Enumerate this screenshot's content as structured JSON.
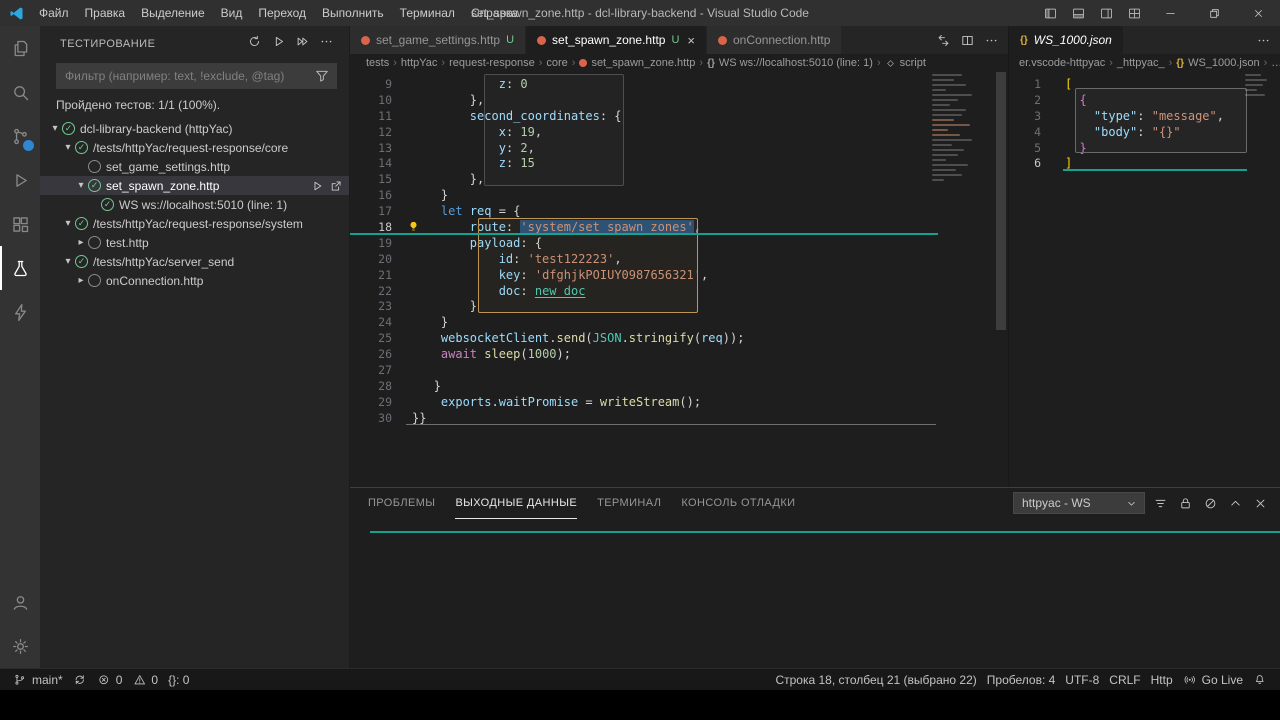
{
  "titlebar": {
    "menus": [
      "Файл",
      "Правка",
      "Выделение",
      "Вид",
      "Переход",
      "Выполнить",
      "Терминал",
      "Справка"
    ],
    "title": "set_spawn_zone.http - dcl-library-backend - Visual Studio Code",
    "layout_controls": [
      {
        "name": "toggle-primary-sidebar",
        "icon": "layoutL"
      },
      {
        "name": "toggle-panel",
        "icon": "layoutB"
      },
      {
        "name": "toggle-secondary-sidebar",
        "icon": "layoutR"
      },
      {
        "name": "customize-layout",
        "icon": "layoutG"
      }
    ],
    "window_controls": [
      {
        "name": "minimize",
        "icon": "minimize"
      },
      {
        "name": "restore",
        "icon": "restore"
      },
      {
        "name": "close-window",
        "icon": "close"
      }
    ]
  },
  "activity_bar": {
    "top": [
      {
        "name": "explorer",
        "icon": "files"
      },
      {
        "name": "search",
        "icon": "search"
      },
      {
        "name": "source-control",
        "icon": "scm",
        "badge": true
      },
      {
        "name": "run-and-debug",
        "icon": "debug"
      },
      {
        "name": "extensions",
        "icon": "ext"
      },
      {
        "name": "testing",
        "icon": "beaker",
        "active": true
      },
      {
        "name": "httpyac",
        "icon": "bolt"
      }
    ],
    "bottom": [
      {
        "name": "accounts",
        "icon": "account"
      },
      {
        "name": "settings",
        "icon": "gear"
      }
    ]
  },
  "sidebar": {
    "title": "ТЕСТИРОВАНИЕ",
    "actions": [
      {
        "name": "refresh-tests",
        "icon": "refresh"
      },
      {
        "name": "run-all-tests",
        "icon": "play"
      },
      {
        "name": "run-selected-tests",
        "icon": "playAll"
      },
      {
        "name": "more-actions",
        "icon": "more"
      }
    ],
    "filter_placeholder": "Фильтр (например: text, !exclude, @tag)",
    "summary": "Пройдено тестов: 1/1 (100%).",
    "tree": [
      {
        "label": "dcl-library-backend (httpYac)",
        "depth": 0,
        "chevron": "down",
        "state": "pass"
      },
      {
        "label": "/tests/httpYac/request-response/core",
        "depth": 1,
        "chevron": "down",
        "state": "pass"
      },
      {
        "label": "set_game_settings.http",
        "depth": 2,
        "chevron": "none",
        "state": "ring"
      },
      {
        "label": "set_spawn_zone.http",
        "depth": 2,
        "chevron": "down",
        "state": "pass",
        "selected": true,
        "actions": [
          "run",
          "goto"
        ]
      },
      {
        "label": "WS ws://localhost:5010 (line: 1)",
        "depth": 3,
        "chevron": "none",
        "state": "pass"
      },
      {
        "label": "/tests/httpYac/request-response/system",
        "depth": 1,
        "chevron": "down",
        "state": "pass"
      },
      {
        "label": "test.http",
        "depth": 2,
        "chevron": "right",
        "state": "ring"
      },
      {
        "label": "/tests/httpYac/server_send",
        "depth": 1,
        "chevron": "down",
        "state": "pass"
      },
      {
        "label": "onConnection.http",
        "depth": 2,
        "chevron": "right",
        "state": "ring"
      }
    ]
  },
  "editor": {
    "tabs": [
      {
        "label": "set_game_settings.http",
        "badge": "U",
        "active": false
      },
      {
        "label": "set_spawn_zone.http",
        "badge": "U",
        "active": true,
        "close": true
      },
      {
        "label": "onConnection.http",
        "badge": "",
        "active": false
      }
    ],
    "tab_actions": [
      {
        "name": "compare-changes",
        "icon": "compare"
      },
      {
        "name": "split-editor",
        "icon": "split"
      },
      {
        "name": "more-editor-actions",
        "icon": "more"
      }
    ],
    "breadcrumbs": [
      {
        "label": "tests"
      },
      {
        "label": "httpYac"
      },
      {
        "label": "request-response"
      },
      {
        "label": "core"
      },
      {
        "label": "set_spawn_zone.http",
        "icon": "file"
      },
      {
        "label": "WS ws://localhost:5010 (line: 1)",
        "icon": "braces"
      },
      {
        "label": "script",
        "icon": "symbol"
      }
    ],
    "lines": [
      {
        "n": 9,
        "i": 12,
        "t": [
          [
            "var",
            "z"
          ],
          [
            "pun",
            ": "
          ],
          [
            "num",
            "0"
          ]
        ]
      },
      {
        "n": 10,
        "i": 8,
        "t": [
          [
            "pun",
            "},"
          ]
        ]
      },
      {
        "n": 11,
        "i": 8,
        "t": [
          [
            "var",
            "second_coordinates"
          ],
          [
            "pun",
            ": {"
          ]
        ]
      },
      {
        "n": 12,
        "i": 12,
        "t": [
          [
            "var",
            "x"
          ],
          [
            "pun",
            ": "
          ],
          [
            "num",
            "19"
          ],
          [
            "pun",
            ","
          ]
        ]
      },
      {
        "n": 13,
        "i": 12,
        "t": [
          [
            "var",
            "y"
          ],
          [
            "pun",
            ": "
          ],
          [
            "num",
            "2"
          ],
          [
            "pun",
            ","
          ]
        ]
      },
      {
        "n": 14,
        "i": 12,
        "t": [
          [
            "var",
            "z"
          ],
          [
            "pun",
            ": "
          ],
          [
            "num",
            "15"
          ]
        ]
      },
      {
        "n": 15,
        "i": 8,
        "t": [
          [
            "pun",
            "},"
          ]
        ]
      },
      {
        "n": 16,
        "i": 4,
        "t": [
          [
            "pun",
            "}"
          ]
        ]
      },
      {
        "n": 17,
        "i": 4,
        "t": [
          [
            "kw",
            "let"
          ],
          [
            "pun",
            " "
          ],
          [
            "var",
            "req"
          ],
          [
            "pun",
            " = {"
          ]
        ]
      },
      {
        "n": 18,
        "i": 8,
        "active": true,
        "t": [
          [
            "var",
            "route"
          ],
          [
            "pun",
            ": "
          ],
          [
            "strsel",
            "'system/set_spawn_zones'"
          ],
          [
            "pun",
            ","
          ]
        ]
      },
      {
        "n": 19,
        "i": 8,
        "t": [
          [
            "var",
            "payload"
          ],
          [
            "pun",
            ": {"
          ]
        ]
      },
      {
        "n": 20,
        "i": 12,
        "t": [
          [
            "var",
            "id"
          ],
          [
            "pun",
            ": "
          ],
          [
            "str",
            "'test122223'"
          ],
          [
            "pun",
            ","
          ]
        ]
      },
      {
        "n": 21,
        "i": 12,
        "t": [
          [
            "var",
            "key"
          ],
          [
            "pun",
            ": "
          ],
          [
            "str",
            "'dfghjkPOIUY0987656321'"
          ],
          [
            "pun",
            ","
          ]
        ]
      },
      {
        "n": 22,
        "i": 12,
        "t": [
          [
            "var",
            "doc"
          ],
          [
            "pun",
            ": "
          ],
          [
            "link",
            "new_doc"
          ]
        ]
      },
      {
        "n": 23,
        "i": 8,
        "t": [
          [
            "pun",
            "}"
          ]
        ]
      },
      {
        "n": 24,
        "i": 4,
        "t": [
          [
            "pun",
            "}"
          ]
        ]
      },
      {
        "n": 25,
        "i": 4,
        "t": [
          [
            "var",
            "websocketClient"
          ],
          [
            "pun",
            "."
          ],
          [
            "fn",
            "send"
          ],
          [
            "pun",
            "("
          ],
          [
            "cls",
            "JSON"
          ],
          [
            "pun",
            "."
          ],
          [
            "fn",
            "stringify"
          ],
          [
            "pun",
            "("
          ],
          [
            "var",
            "req"
          ],
          [
            "pun",
            "));"
          ]
        ]
      },
      {
        "n": 26,
        "i": 4,
        "t": [
          [
            "ctrl",
            "await"
          ],
          [
            "pun",
            " "
          ],
          [
            "fn",
            "sleep"
          ],
          [
            "pun",
            "("
          ],
          [
            "num",
            "1000"
          ],
          [
            "pun",
            ");"
          ]
        ]
      },
      {
        "n": 27,
        "i": 0,
        "t": []
      },
      {
        "n": 28,
        "i": 3,
        "t": [
          [
            "pun",
            "}"
          ]
        ]
      },
      {
        "n": 29,
        "i": 4,
        "t": [
          [
            "var",
            "exports"
          ],
          [
            "pun",
            "."
          ],
          [
            "var",
            "waitPromise"
          ],
          [
            "pun",
            " = "
          ],
          [
            "fn",
            "writeStream"
          ],
          [
            "pun",
            "();"
          ]
        ]
      },
      {
        "n": 30,
        "i": 0,
        "t": [
          [
            "pun",
            "}}"
          ]
        ]
      }
    ]
  },
  "editor2": {
    "tab": {
      "label": "WS_1000.json"
    },
    "tab_actions": [
      {
        "name": "more-editor-actions",
        "icon": "more"
      }
    ],
    "breadcrumbs": [
      {
        "label": "er.vscode-httpyac"
      },
      {
        "label": "_httpyac_"
      },
      {
        "label": "WS_1000.json",
        "icon": "braces-gold"
      },
      {
        "label": "…"
      }
    ],
    "lines": [
      {
        "n": 1,
        "i": 0,
        "t": [
          [
            "brk",
            "["
          ]
        ]
      },
      {
        "n": 2,
        "i": 2,
        "t": [
          [
            "brk2",
            "{"
          ]
        ]
      },
      {
        "n": 3,
        "i": 4,
        "t": [
          [
            "key",
            "\"type\""
          ],
          [
            "pun",
            ": "
          ],
          [
            "str",
            "\"message\""
          ],
          [
            "pun",
            ","
          ]
        ]
      },
      {
        "n": 4,
        "i": 4,
        "t": [
          [
            "key",
            "\"body\""
          ],
          [
            "pun",
            ": "
          ],
          [
            "str",
            "\"{}\""
          ]
        ]
      },
      {
        "n": 5,
        "i": 2,
        "t": [
          [
            "brk2",
            "}"
          ]
        ]
      },
      {
        "n": 6,
        "i": 0,
        "active": true,
        "t": [
          [
            "brk",
            "]"
          ]
        ]
      }
    ]
  },
  "panel": {
    "tabs": [
      {
        "label": "ПРОБЛЕМЫ",
        "active": false
      },
      {
        "label": "ВЫХОДНЫЕ ДАННЫЕ",
        "active": true
      },
      {
        "label": "ТЕРМИНАЛ",
        "active": false
      },
      {
        "label": "КОНСОЛЬ ОТЛАДКИ",
        "active": false
      }
    ],
    "output_channel": "httpyac - WS",
    "actions": [
      {
        "name": "filter-output",
        "icon": "filterLines"
      },
      {
        "name": "lock-scroll",
        "icon": "lock"
      },
      {
        "name": "clear-output",
        "icon": "clear"
      },
      {
        "name": "maximize-panel",
        "icon": "chevUp"
      },
      {
        "name": "close-panel",
        "icon": "close"
      }
    ]
  },
  "status_bar": {
    "left": [
      {
        "name": "git-branch",
        "icon": "branch",
        "label": "main*"
      },
      {
        "name": "sync-changes",
        "icon": "sync",
        "label": ""
      },
      {
        "name": "problems-errors",
        "icon": "errorC",
        "label": "0"
      },
      {
        "name": "problems-warnings",
        "icon": "warn",
        "label": "0"
      },
      {
        "name": "httpyac-env",
        "icon": null,
        "label": "{}: 0"
      }
    ],
    "right": [
      {
        "name": "cursor-position",
        "label": "Строка 18, столбец 21 (выбрано 22)"
      },
      {
        "name": "indentation",
        "label": "Пробелов: 4"
      },
      {
        "name": "encoding",
        "label": "UTF-8"
      },
      {
        "name": "eol",
        "label": "CRLF"
      },
      {
        "name": "language-mode",
        "label": "Http"
      },
      {
        "name": "go-live",
        "icon": "broadcast",
        "label": "Go Live"
      },
      {
        "name": "notifications",
        "icon": "bell",
        "label": ""
      }
    ]
  },
  "colors": {
    "teal_decoration": "#12a390",
    "snippet_border": "#c09553",
    "selection": "#264f78",
    "test_pass": "#73c991",
    "git_untracked": "#73c991",
    "scm_badge": "#2f86d1"
  }
}
